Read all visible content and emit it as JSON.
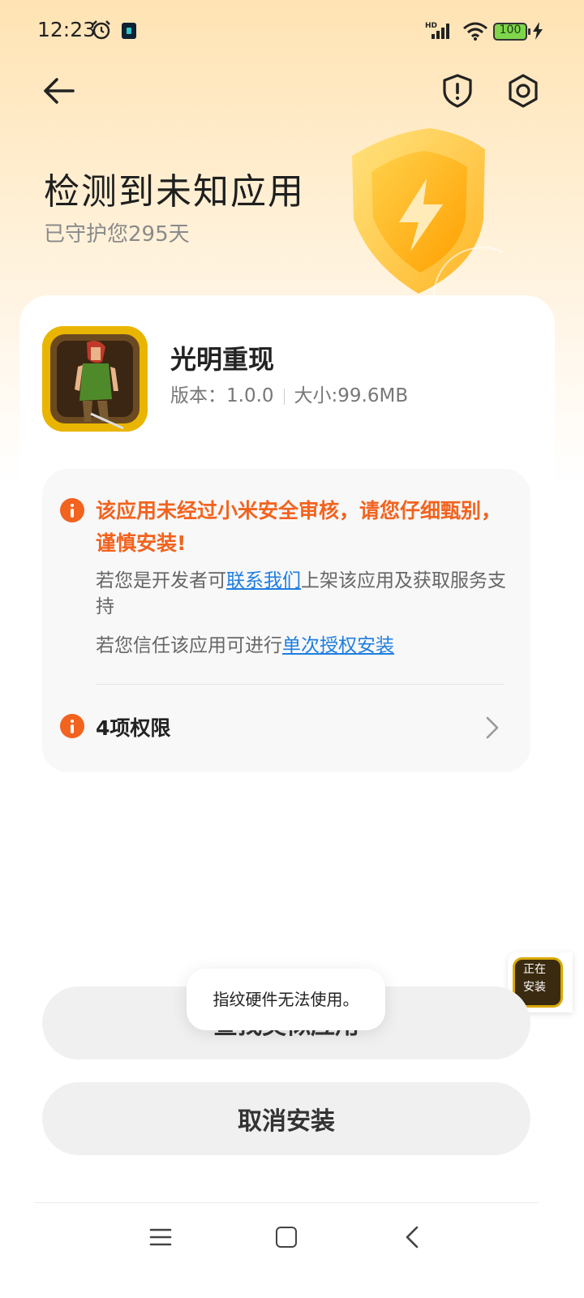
{
  "status_bar": {
    "time": "12:23",
    "signal_badge": "HD",
    "battery_level": "100",
    "icons": [
      "alarm-icon",
      "app-lock-icon",
      "signal-icon",
      "wifi-icon",
      "battery-icon",
      "charging-icon"
    ]
  },
  "header": {
    "back_icon": "arrow-left-icon",
    "actions": [
      "shield-alert-icon",
      "settings-hexagon-icon"
    ],
    "title": "检测到未知应用",
    "subtitle": "已守护您295天"
  },
  "app": {
    "name": "光明重现",
    "version_label": "版本：1.0.0",
    "size_label": "大小:99.6MB"
  },
  "warning": {
    "title": "该应用未经过小米安全审核，请您仔细甄别，谨慎安装!",
    "dev_prefix": "若您是开发者可",
    "dev_link": "联系我们",
    "dev_suffix": "上架该应用及获取服务支持",
    "trust_prefix": "若您信任该应用可进行",
    "trust_link": "单次授权安装",
    "permissions": "4项权限"
  },
  "float_widget": {
    "line1": "正在",
    "line2": "安装"
  },
  "buttons": {
    "similar": "查找类似应用",
    "cancel": "取消安装"
  },
  "toast": "指纹硬件无法使用。",
  "colors": {
    "accent_orange": "#f2631f",
    "link_blue": "#1f7ee0",
    "header_gradient_top": "#ffe3b3"
  }
}
